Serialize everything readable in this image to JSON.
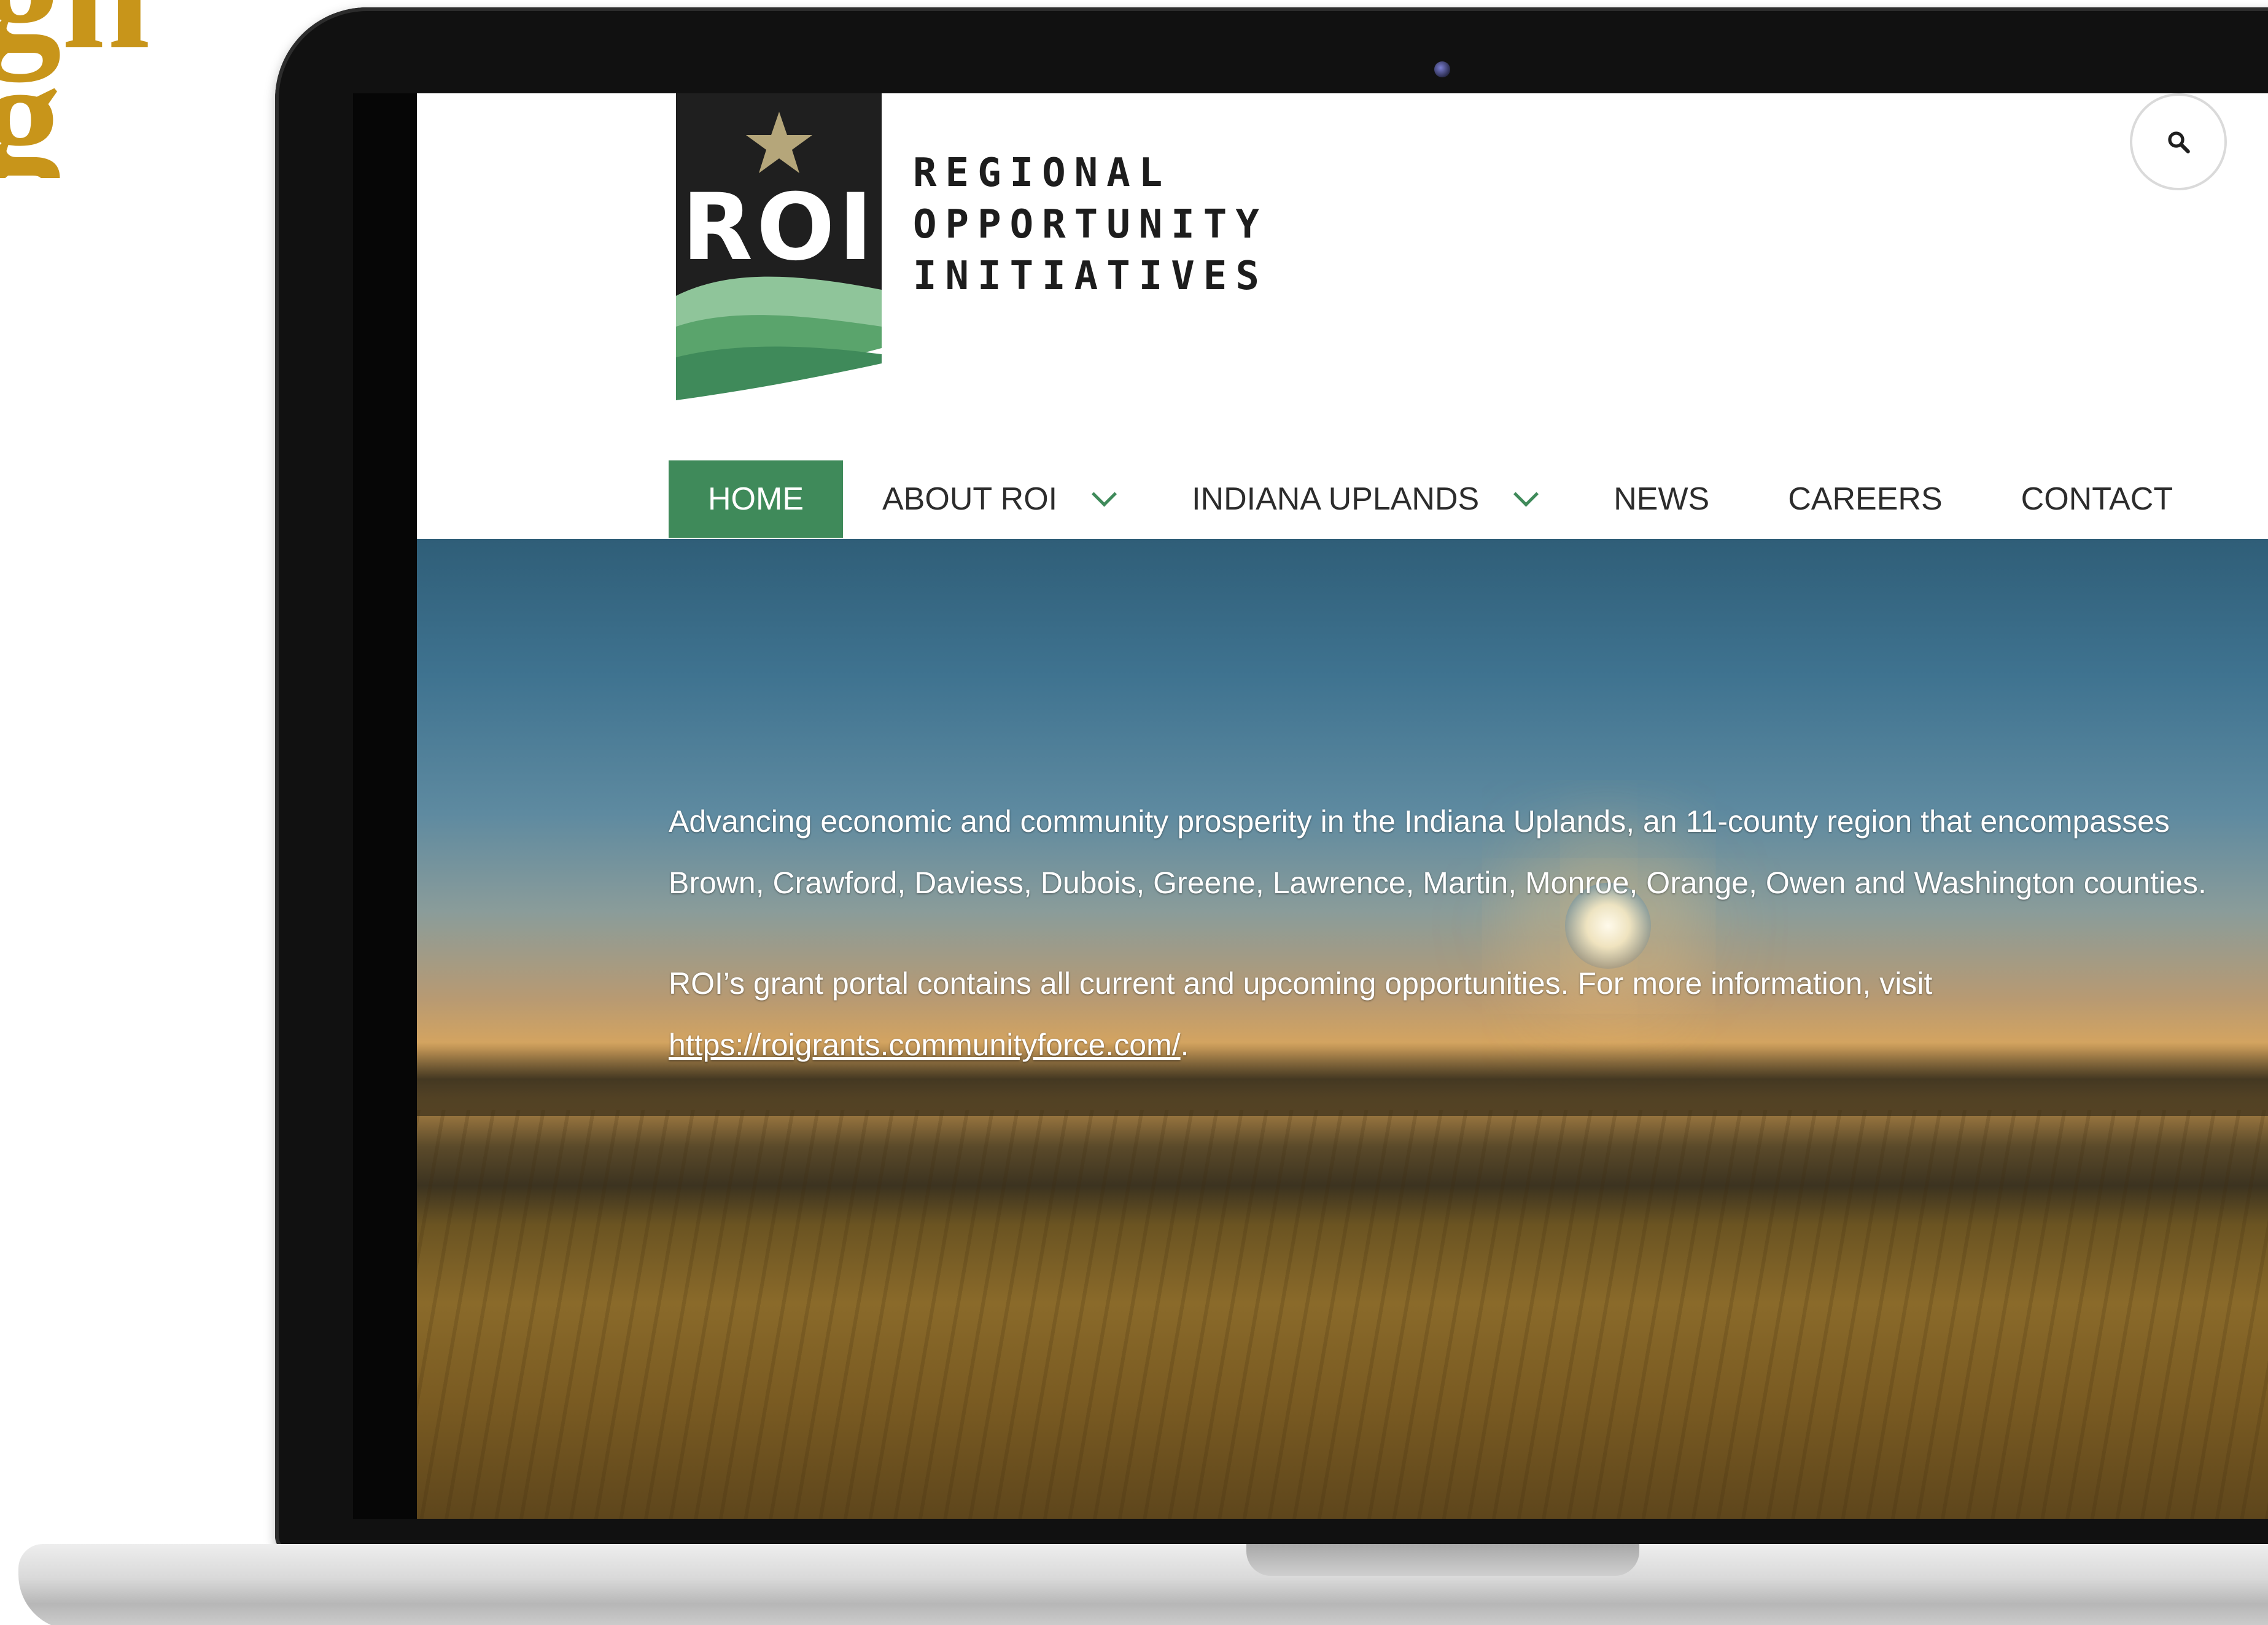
{
  "site": {
    "logo_mark_text": "ROI",
    "logo_lines": [
      "REGIONAL",
      "OPPORTUNITY",
      "INITIATIVES"
    ]
  },
  "nav": {
    "items": [
      {
        "label": "HOME",
        "active": true,
        "dropdown": false
      },
      {
        "label": "ABOUT ROI",
        "active": false,
        "dropdown": true
      },
      {
        "label": "INDIANA UPLANDS",
        "active": false,
        "dropdown": true
      },
      {
        "label": "NEWS",
        "active": false,
        "dropdown": false
      },
      {
        "label": "CAREERS",
        "active": false,
        "dropdown": false
      },
      {
        "label": "CONTACT",
        "active": false,
        "dropdown": false
      }
    ]
  },
  "search": {
    "icon": "search-icon"
  },
  "hero": {
    "paragraph1": "Advancing economic and community prosperity in the Indiana Uplands, an 11-county region that encompasses Brown, Crawford, Daviess, Dubois, Greene, Lawrence, Martin, Monroe, Orange, Owen and Washington counties.",
    "paragraph2_prefix": "ROI’s grant portal contains all current and upcoming opportunities. For more information, visit ",
    "paragraph2_link": "https://roigrants.communityforce.com/",
    "paragraph2_suffix": "."
  },
  "colors": {
    "accent_green": "#3f8a5a",
    "logo_dark": "#1d1d1d",
    "corner_heading": "#c8951a"
  }
}
